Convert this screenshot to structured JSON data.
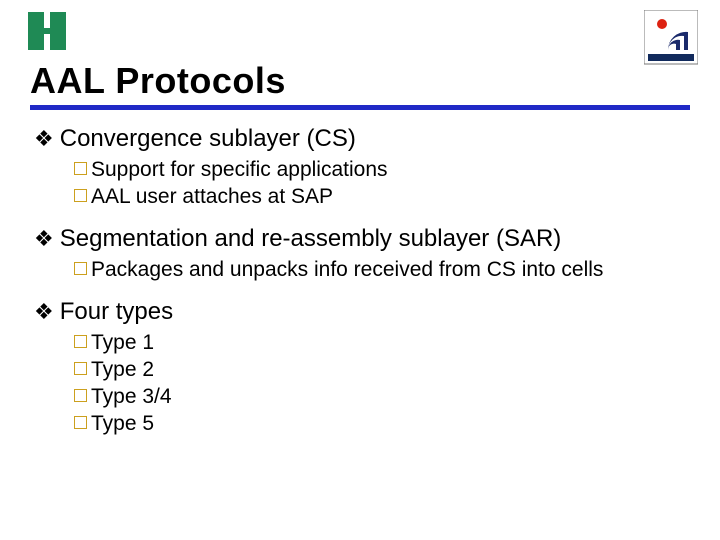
{
  "title": "AAL Protocols",
  "sections": [
    {
      "heading": "Convergence sublayer (CS)",
      "items": [
        "Support for specific applications",
        "AAL user attaches at SAP"
      ]
    },
    {
      "heading": "Segmentation and re-assembly sublayer (SAR)",
      "items": [
        "Packages and unpacks info received from CS into cells"
      ]
    },
    {
      "heading": "Four types",
      "items": [
        "Type 1",
        "Type 2",
        "Type 3/4",
        "Type 5"
      ]
    }
  ]
}
